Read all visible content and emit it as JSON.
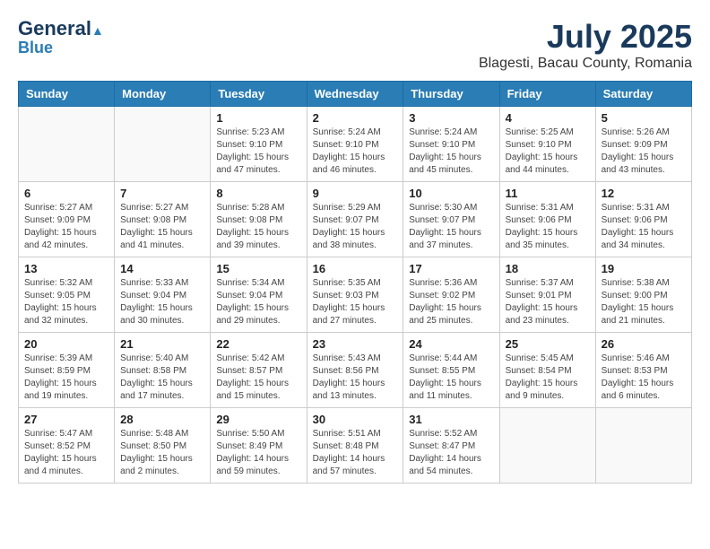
{
  "header": {
    "logo_line1": "General",
    "logo_line2": "Blue",
    "title": "July 2025",
    "subtitle": "Blagesti, Bacau County, Romania"
  },
  "columns": [
    "Sunday",
    "Monday",
    "Tuesday",
    "Wednesday",
    "Thursday",
    "Friday",
    "Saturday"
  ],
  "weeks": [
    [
      {
        "day": "",
        "info": ""
      },
      {
        "day": "",
        "info": ""
      },
      {
        "day": "1",
        "info": "Sunrise: 5:23 AM\nSunset: 9:10 PM\nDaylight: 15 hours and 47 minutes."
      },
      {
        "day": "2",
        "info": "Sunrise: 5:24 AM\nSunset: 9:10 PM\nDaylight: 15 hours and 46 minutes."
      },
      {
        "day": "3",
        "info": "Sunrise: 5:24 AM\nSunset: 9:10 PM\nDaylight: 15 hours and 45 minutes."
      },
      {
        "day": "4",
        "info": "Sunrise: 5:25 AM\nSunset: 9:10 PM\nDaylight: 15 hours and 44 minutes."
      },
      {
        "day": "5",
        "info": "Sunrise: 5:26 AM\nSunset: 9:09 PM\nDaylight: 15 hours and 43 minutes."
      }
    ],
    [
      {
        "day": "6",
        "info": "Sunrise: 5:27 AM\nSunset: 9:09 PM\nDaylight: 15 hours and 42 minutes."
      },
      {
        "day": "7",
        "info": "Sunrise: 5:27 AM\nSunset: 9:08 PM\nDaylight: 15 hours and 41 minutes."
      },
      {
        "day": "8",
        "info": "Sunrise: 5:28 AM\nSunset: 9:08 PM\nDaylight: 15 hours and 39 minutes."
      },
      {
        "day": "9",
        "info": "Sunrise: 5:29 AM\nSunset: 9:07 PM\nDaylight: 15 hours and 38 minutes."
      },
      {
        "day": "10",
        "info": "Sunrise: 5:30 AM\nSunset: 9:07 PM\nDaylight: 15 hours and 37 minutes."
      },
      {
        "day": "11",
        "info": "Sunrise: 5:31 AM\nSunset: 9:06 PM\nDaylight: 15 hours and 35 minutes."
      },
      {
        "day": "12",
        "info": "Sunrise: 5:31 AM\nSunset: 9:06 PM\nDaylight: 15 hours and 34 minutes."
      }
    ],
    [
      {
        "day": "13",
        "info": "Sunrise: 5:32 AM\nSunset: 9:05 PM\nDaylight: 15 hours and 32 minutes."
      },
      {
        "day": "14",
        "info": "Sunrise: 5:33 AM\nSunset: 9:04 PM\nDaylight: 15 hours and 30 minutes."
      },
      {
        "day": "15",
        "info": "Sunrise: 5:34 AM\nSunset: 9:04 PM\nDaylight: 15 hours and 29 minutes."
      },
      {
        "day": "16",
        "info": "Sunrise: 5:35 AM\nSunset: 9:03 PM\nDaylight: 15 hours and 27 minutes."
      },
      {
        "day": "17",
        "info": "Sunrise: 5:36 AM\nSunset: 9:02 PM\nDaylight: 15 hours and 25 minutes."
      },
      {
        "day": "18",
        "info": "Sunrise: 5:37 AM\nSunset: 9:01 PM\nDaylight: 15 hours and 23 minutes."
      },
      {
        "day": "19",
        "info": "Sunrise: 5:38 AM\nSunset: 9:00 PM\nDaylight: 15 hours and 21 minutes."
      }
    ],
    [
      {
        "day": "20",
        "info": "Sunrise: 5:39 AM\nSunset: 8:59 PM\nDaylight: 15 hours and 19 minutes."
      },
      {
        "day": "21",
        "info": "Sunrise: 5:40 AM\nSunset: 8:58 PM\nDaylight: 15 hours and 17 minutes."
      },
      {
        "day": "22",
        "info": "Sunrise: 5:42 AM\nSunset: 8:57 PM\nDaylight: 15 hours and 15 minutes."
      },
      {
        "day": "23",
        "info": "Sunrise: 5:43 AM\nSunset: 8:56 PM\nDaylight: 15 hours and 13 minutes."
      },
      {
        "day": "24",
        "info": "Sunrise: 5:44 AM\nSunset: 8:55 PM\nDaylight: 15 hours and 11 minutes."
      },
      {
        "day": "25",
        "info": "Sunrise: 5:45 AM\nSunset: 8:54 PM\nDaylight: 15 hours and 9 minutes."
      },
      {
        "day": "26",
        "info": "Sunrise: 5:46 AM\nSunset: 8:53 PM\nDaylight: 15 hours and 6 minutes."
      }
    ],
    [
      {
        "day": "27",
        "info": "Sunrise: 5:47 AM\nSunset: 8:52 PM\nDaylight: 15 hours and 4 minutes."
      },
      {
        "day": "28",
        "info": "Sunrise: 5:48 AM\nSunset: 8:50 PM\nDaylight: 15 hours and 2 minutes."
      },
      {
        "day": "29",
        "info": "Sunrise: 5:50 AM\nSunset: 8:49 PM\nDaylight: 14 hours and 59 minutes."
      },
      {
        "day": "30",
        "info": "Sunrise: 5:51 AM\nSunset: 8:48 PM\nDaylight: 14 hours and 57 minutes."
      },
      {
        "day": "31",
        "info": "Sunrise: 5:52 AM\nSunset: 8:47 PM\nDaylight: 14 hours and 54 minutes."
      },
      {
        "day": "",
        "info": ""
      },
      {
        "day": "",
        "info": ""
      }
    ]
  ]
}
